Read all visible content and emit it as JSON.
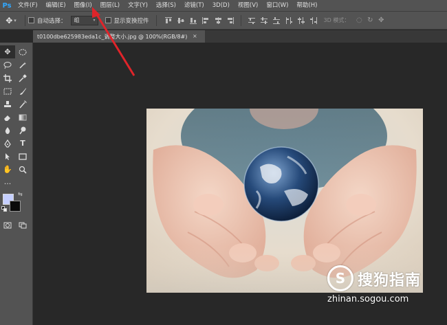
{
  "app": {
    "logo": "Ps",
    "menu": [
      "文件(F)",
      "编辑(E)",
      "图像(I)",
      "图层(L)",
      "文字(Y)",
      "选择(S)",
      "滤镜(T)",
      "3D(D)",
      "视图(V)",
      "窗口(W)",
      "帮助(H)"
    ]
  },
  "options": {
    "auto_select_label": "自动选择：",
    "auto_select_value": "组",
    "show_transform_label": "显示变换控件",
    "mode_3d_label": "3D 模式："
  },
  "document": {
    "tab_title": "t0100dbe625983eda1c_调整大小.jpg @ 100%(RGB/8#)",
    "close": "×"
  },
  "colors": {
    "foreground": "#c5cfff",
    "background": "#0a0a0a",
    "annotation_arrow": "#e0242a"
  },
  "watermark": {
    "brand": "搜狗指南",
    "logo_letter": "S",
    "url": "zhinan.sogou.com"
  }
}
